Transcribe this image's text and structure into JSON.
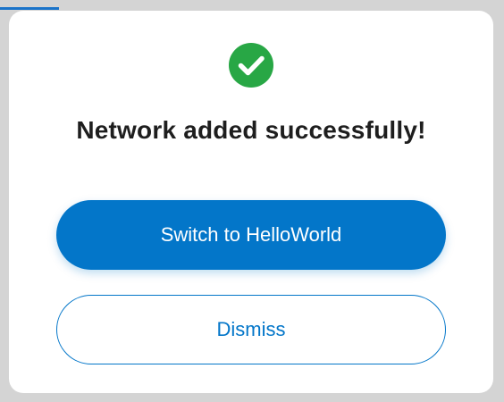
{
  "dialog": {
    "title": "Network added successfully!",
    "primary_button_label": "Switch to HelloWorld",
    "secondary_button_label": "Dismiss",
    "icon": "check-circle-icon"
  },
  "colors": {
    "success": "#28a745",
    "accent": "#0376c9",
    "title_text": "#1e1e1e",
    "modal_background": "#ffffff",
    "backdrop": "#d4d4d4"
  }
}
